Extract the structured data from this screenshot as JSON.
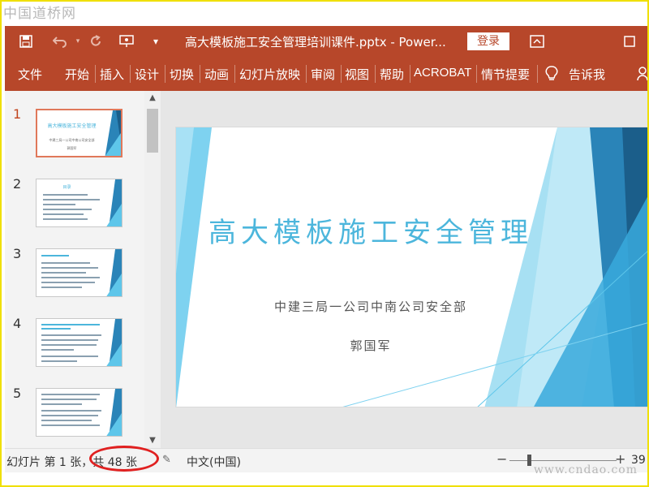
{
  "watermark": {
    "top": "中国道桥网",
    "bottom": "www.cndao.com"
  },
  "titlebar": {
    "title": "高大模板施工安全管理培训课件.pptx  -  Power...",
    "login": "登录",
    "icons": [
      "save-icon",
      "undo-icon",
      "redo-icon",
      "present-icon",
      "customize-icon",
      "ribbon-display-icon",
      "maximize-icon"
    ]
  },
  "ribbon": {
    "tabs": [
      "文件",
      "开始",
      "插入",
      "设计",
      "切换",
      "动画",
      "幻灯片放映",
      "审阅",
      "视图",
      "帮助",
      "ACROBAT",
      "情节提要"
    ],
    "tell_me": "告诉我",
    "icons": [
      "lightbulb-icon"
    ]
  },
  "thumbnails": [
    {
      "num": "1",
      "title": "高大模板施工安全管理",
      "sub": "中建三局一公司中南公司安全部",
      "author": "郭国军"
    },
    {
      "num": "2",
      "title": "目录"
    },
    {
      "num": "3"
    },
    {
      "num": "4"
    },
    {
      "num": "5"
    }
  ],
  "slide": {
    "title": "高大模板施工安全管理",
    "subtitle": "中建三局一公司中南公司安全部",
    "author": "郭国军"
  },
  "status": {
    "slide_info": "幻灯片 第 1 张，共 48 张",
    "language": "中文(中国)",
    "zoom": "39",
    "zoom_minus": "−",
    "zoom_plus": "+"
  },
  "colors": {
    "accent": "#b7472a",
    "slide_title": "#4cb6dc",
    "annotation": "#e02020"
  }
}
